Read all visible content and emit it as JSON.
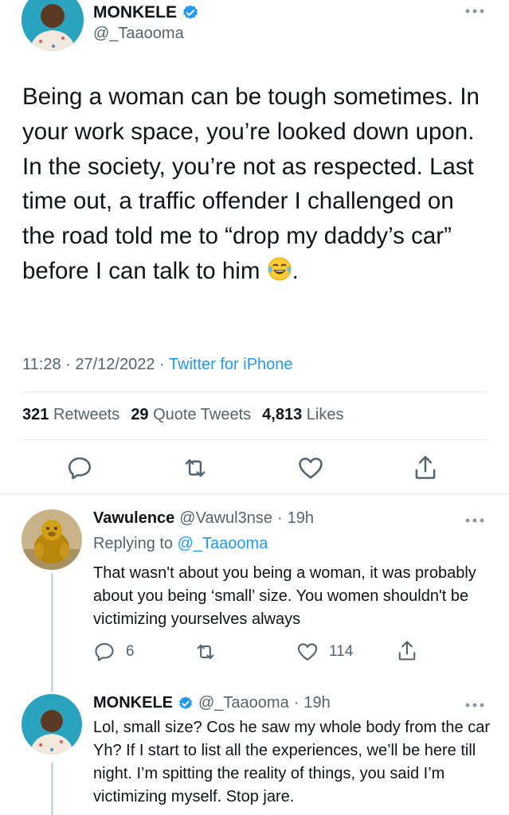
{
  "main_tweet": {
    "author_name": "MONKELE",
    "author_handle": "@_Taaooma",
    "text": "Being a woman can be tough sometimes. In your work space, you’re looked down upon. In the society, you’re not as respected. Last time out, a traffic offender I challenged on the road told me to “drop my daddy’s car” before I can talk to him",
    "text_end": ".",
    "time": "11:28",
    "date": "27/12/2022",
    "source": "Twitter for iPhone",
    "separator": "·",
    "stats": {
      "retweets_count": "321",
      "retweets_label": "Retweets",
      "quotes_count": "29",
      "quotes_label": "Quote Tweets",
      "likes_count": "4,813",
      "likes_label": "Likes"
    }
  },
  "replies": [
    {
      "author_name": "Vawulence",
      "author_handle": "@Vawul3nse",
      "time": "19h",
      "replying_prefix": "Replying to",
      "replying_handle": "@_Taaooma",
      "text": "That wasn't about you being a woman, it was probably about you being ‘small’ size.  You women shouldn't be victimizing yourselves always",
      "reply_count": "6",
      "retweet_count": "",
      "like_count": "114"
    },
    {
      "author_name": "MONKELE",
      "author_handle": "@_Taaooma",
      "time": "19h",
      "text": "Lol, small size? Cos he saw my whole body from the car Yh? If I start to list all the experiences, we’ll be here till night. I’m spitting the reality of things, you said I’m victimizing myself. Stop jare."
    }
  ],
  "colors": {
    "link": "#1d9bf0",
    "secondary_text": "#536471",
    "verified": "#1d9bf0",
    "divider": "#e6ecf0"
  },
  "icons": [
    "verified-badge-icon",
    "more-icon",
    "reply-icon",
    "retweet-icon",
    "like-icon",
    "share-icon",
    "laughing-tears-emoji"
  ]
}
